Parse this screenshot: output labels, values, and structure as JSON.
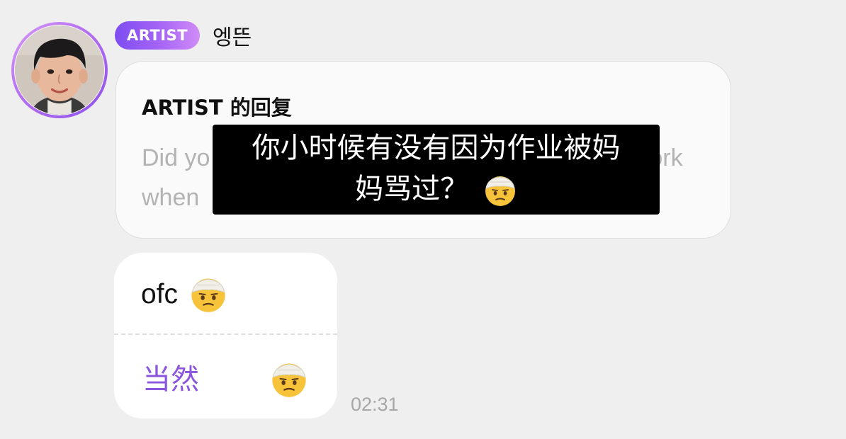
{
  "header": {
    "badge_label": "ARTIST",
    "username": "엥뜬"
  },
  "avatar": {
    "icon": "avatar-photo",
    "ring_color": "#b46ef0"
  },
  "reply": {
    "title": "ARTIST 的回复",
    "body_line1_start": "Did yo",
    "body_line1_end": "ork",
    "body_line2": "when"
  },
  "subtitle": {
    "line1": "你小时候有没有因为作业被妈",
    "line2": "妈骂过？",
    "emoji": "head-bandage-emoji"
  },
  "message": {
    "original_text": "ofc",
    "original_emoji": "head-bandage-emoji",
    "translation_text": "当然",
    "translation_emoji": "head-bandage-emoji",
    "time": "02:31"
  },
  "colors": {
    "background": "#efefef",
    "accent_purple": "#8b55de",
    "badge_gradient_start": "#7d4df2",
    "badge_gradient_end": "#d08cf7",
    "subtitle_background": "#000000"
  }
}
